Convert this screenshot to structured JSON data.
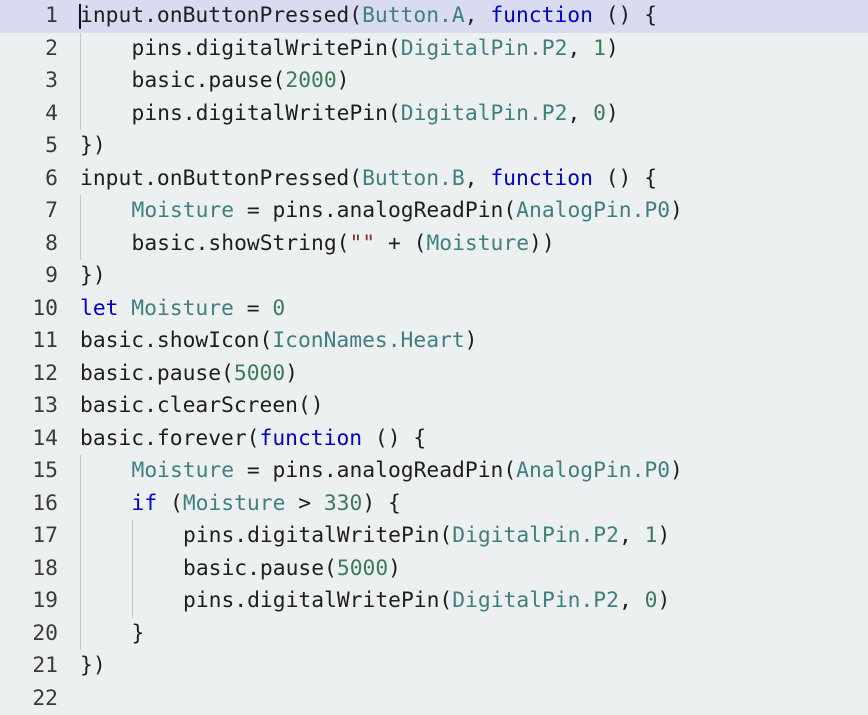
{
  "editor": {
    "language": "typescript",
    "current_line": 1,
    "colors": {
      "background": "#edf0f0",
      "current_line_highlight": "#d9dcf1",
      "keyword": "#0000cd",
      "type": "#3f7f7f",
      "number": "#3d7a5a",
      "string": "#8b2b2b",
      "text": "#1e1e1e"
    },
    "lines": [
      {
        "n": "1",
        "indent": 0,
        "tokens": [
          [
            "p",
            "input.onButtonPressed("
          ],
          [
            "ty",
            "Button.A"
          ],
          [
            "p",
            ", "
          ],
          [
            "kw",
            "function"
          ],
          [
            "p",
            " () {"
          ]
        ]
      },
      {
        "n": "2",
        "indent": 1,
        "tokens": [
          [
            "p",
            "pins.digitalWritePin("
          ],
          [
            "ty",
            "DigitalPin.P2"
          ],
          [
            "p",
            ", "
          ],
          [
            "num",
            "1"
          ],
          [
            "p",
            ")"
          ]
        ]
      },
      {
        "n": "3",
        "indent": 1,
        "tokens": [
          [
            "p",
            "basic.pause("
          ],
          [
            "num",
            "2000"
          ],
          [
            "p",
            ")"
          ]
        ]
      },
      {
        "n": "4",
        "indent": 1,
        "tokens": [
          [
            "p",
            "pins.digitalWritePin("
          ],
          [
            "ty",
            "DigitalPin.P2"
          ],
          [
            "p",
            ", "
          ],
          [
            "num",
            "0"
          ],
          [
            "p",
            ")"
          ]
        ]
      },
      {
        "n": "5",
        "indent": 0,
        "tokens": [
          [
            "p",
            "})"
          ]
        ]
      },
      {
        "n": "6",
        "indent": 0,
        "tokens": [
          [
            "p",
            "input.onButtonPressed("
          ],
          [
            "ty",
            "Button.B"
          ],
          [
            "p",
            ", "
          ],
          [
            "kw",
            "function"
          ],
          [
            "p",
            " () {"
          ]
        ]
      },
      {
        "n": "7",
        "indent": 1,
        "tokens": [
          [
            "var",
            "Moisture"
          ],
          [
            "p",
            " = pins.analogReadPin("
          ],
          [
            "ty",
            "AnalogPin.P0"
          ],
          [
            "p",
            ")"
          ]
        ]
      },
      {
        "n": "8",
        "indent": 1,
        "tokens": [
          [
            "p",
            "basic.showString("
          ],
          [
            "str",
            "\"\""
          ],
          [
            "p",
            " + ("
          ],
          [
            "var",
            "Moisture"
          ],
          [
            "p",
            "))"
          ]
        ]
      },
      {
        "n": "9",
        "indent": 0,
        "tokens": [
          [
            "p",
            "})"
          ]
        ]
      },
      {
        "n": "10",
        "indent": 0,
        "tokens": [
          [
            "kw",
            "let"
          ],
          [
            "p",
            " "
          ],
          [
            "var",
            "Moisture"
          ],
          [
            "p",
            " = "
          ],
          [
            "num",
            "0"
          ]
        ]
      },
      {
        "n": "11",
        "indent": 0,
        "tokens": [
          [
            "p",
            "basic.showIcon("
          ],
          [
            "ty",
            "IconNames.Heart"
          ],
          [
            "p",
            ")"
          ]
        ]
      },
      {
        "n": "12",
        "indent": 0,
        "tokens": [
          [
            "p",
            "basic.pause("
          ],
          [
            "num",
            "5000"
          ],
          [
            "p",
            ")"
          ]
        ]
      },
      {
        "n": "13",
        "indent": 0,
        "tokens": [
          [
            "p",
            "basic.clearScreen()"
          ]
        ]
      },
      {
        "n": "14",
        "indent": 0,
        "tokens": [
          [
            "p",
            "basic.forever("
          ],
          [
            "kw",
            "function"
          ],
          [
            "p",
            " () {"
          ]
        ]
      },
      {
        "n": "15",
        "indent": 1,
        "tokens": [
          [
            "var",
            "Moisture"
          ],
          [
            "p",
            " = pins.analogReadPin("
          ],
          [
            "ty",
            "AnalogPin.P0"
          ],
          [
            "p",
            ")"
          ]
        ]
      },
      {
        "n": "16",
        "indent": 1,
        "tokens": [
          [
            "kw",
            "if"
          ],
          [
            "p",
            " ("
          ],
          [
            "var",
            "Moisture"
          ],
          [
            "p",
            " > "
          ],
          [
            "num",
            "330"
          ],
          [
            "p",
            ") {"
          ]
        ]
      },
      {
        "n": "17",
        "indent": 2,
        "tokens": [
          [
            "p",
            "pins.digitalWritePin("
          ],
          [
            "ty",
            "DigitalPin.P2"
          ],
          [
            "p",
            ", "
          ],
          [
            "num",
            "1"
          ],
          [
            "p",
            ")"
          ]
        ]
      },
      {
        "n": "18",
        "indent": 2,
        "tokens": [
          [
            "p",
            "basic.pause("
          ],
          [
            "num",
            "5000"
          ],
          [
            "p",
            ")"
          ]
        ]
      },
      {
        "n": "19",
        "indent": 2,
        "tokens": [
          [
            "p",
            "pins.digitalWritePin("
          ],
          [
            "ty",
            "DigitalPin.P2"
          ],
          [
            "p",
            ", "
          ],
          [
            "num",
            "0"
          ],
          [
            "p",
            ")"
          ]
        ]
      },
      {
        "n": "20",
        "indent": 1,
        "tokens": [
          [
            "p",
            "}"
          ]
        ]
      },
      {
        "n": "21",
        "indent": 0,
        "tokens": [
          [
            "p",
            "})"
          ]
        ]
      },
      {
        "n": "22",
        "indent": 0,
        "tokens": []
      }
    ],
    "indent_guides": [
      {
        "from": 2,
        "to": 4,
        "level": 1
      },
      {
        "from": 7,
        "to": 8,
        "level": 1
      },
      {
        "from": 15,
        "to": 20,
        "level": 1
      },
      {
        "from": 17,
        "to": 19,
        "level": 2
      }
    ]
  }
}
